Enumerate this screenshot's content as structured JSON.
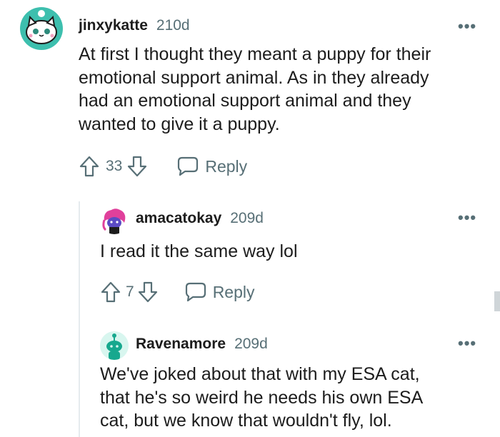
{
  "comments": [
    {
      "username": "jinxykatte",
      "age": "210d",
      "body": [
        "At first I thought they meant a puppy for their",
        "emotional support animal. As in they already",
        "had an emotional support animal and they",
        "wanted to give it a puppy."
      ],
      "votes": "33",
      "reply_label": "Reply",
      "more": "•••",
      "avatar_colors": {
        "bg": "#3dbfae",
        "face": "#ffffff"
      }
    },
    {
      "username": "amacatokay",
      "age": "209d",
      "body": [
        "I read it the same way lol"
      ],
      "votes": "7",
      "reply_label": "Reply",
      "more": "•••",
      "avatar_colors": {
        "hair": "#e0409b",
        "face": "#5b4bc4"
      }
    },
    {
      "username": "Ravenamore",
      "age": "209d",
      "body": [
        "We've joked about that with my ESA cat,",
        "that he's so weird he needs his own ESA",
        "cat, but we know that wouldn't fly, lol."
      ],
      "more": "•••",
      "avatar_colors": {
        "bg": "#d8f6ef",
        "figure": "#17a88e"
      }
    }
  ],
  "colors": {
    "meta_gray": "#576f76",
    "text": "#1c1c1c",
    "line": "#e5ebee"
  }
}
